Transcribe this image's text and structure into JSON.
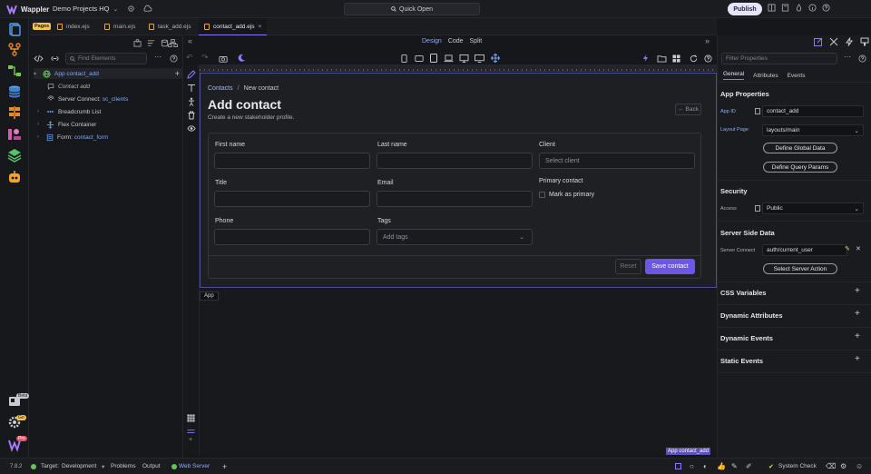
{
  "app": {
    "brand": "Wappler",
    "project": "Demo Projects HQ",
    "quick_open": "Quick Open",
    "publish": "Publish"
  },
  "structure": {
    "pages_chip": "Pages",
    "find_placeholder": "Find Elements",
    "tree": [
      {
        "label": "App",
        "binding": "contact_add"
      },
      {
        "label": "Contact add"
      },
      {
        "label": "Server Connect:",
        "binding": "sc_clients"
      },
      {
        "label": "Breadcrumb List"
      },
      {
        "label": "Flex Container"
      },
      {
        "label": "Form:",
        "binding": "contact_form"
      }
    ]
  },
  "tabs": [
    {
      "label": "index.ejs"
    },
    {
      "label": "main.ejs"
    },
    {
      "label": "task_add.ejs"
    },
    {
      "label": "contact_add.ejs"
    }
  ],
  "modes": [
    "Design",
    "Code",
    "Split"
  ],
  "canvas": {
    "breadcrumb": {
      "parent": "Contacts",
      "sep": "/",
      "current": "New contact"
    },
    "title": "Add contact",
    "subtitle": "Create a new stakeholder profile.",
    "back": "Back",
    "fields": {
      "first_name": "First name",
      "last_name": "Last name",
      "client": "Client",
      "client_placeholder": "Select client",
      "title": "Title",
      "email": "Email",
      "primary_contact": "Primary contact",
      "mark_primary": "Mark as primary",
      "phone": "Phone",
      "tags": "Tags",
      "tags_placeholder": "Add tags"
    },
    "reset": "Reset",
    "save": "Save contact",
    "app_chip": "App",
    "app_tag": "App contact_add"
  },
  "props": {
    "search_placeholder": "Filter Properties",
    "tabs": [
      "General",
      "Attributes",
      "Events"
    ],
    "app_properties": "App Properties",
    "app_id_label": "App ID",
    "app_id": "contact_add",
    "layout_label": "Layout Page",
    "layout": "layouts/main",
    "define_global": "Define Global Data",
    "define_query": "Define Query Params",
    "security": "Security",
    "access_label": "Access",
    "access": "Public",
    "ssd": "Server Side Data",
    "sc_label": "Server Connect",
    "sc_value": "auth/current_user",
    "select_action": "Select Server Action",
    "sections": [
      "CSS Variables",
      "Dynamic Attributes",
      "Dynamic Events",
      "Static Events"
    ]
  },
  "status": {
    "version": "7.8.2",
    "target": "Target:",
    "target_value": "Development",
    "problems": "Problems",
    "output": "Output",
    "web_server": "Web Server",
    "system_check": "System Check"
  },
  "colors": {
    "accent": "#6d55e8",
    "selection": "#4b4f9c",
    "link": "#7ea7ff"
  }
}
